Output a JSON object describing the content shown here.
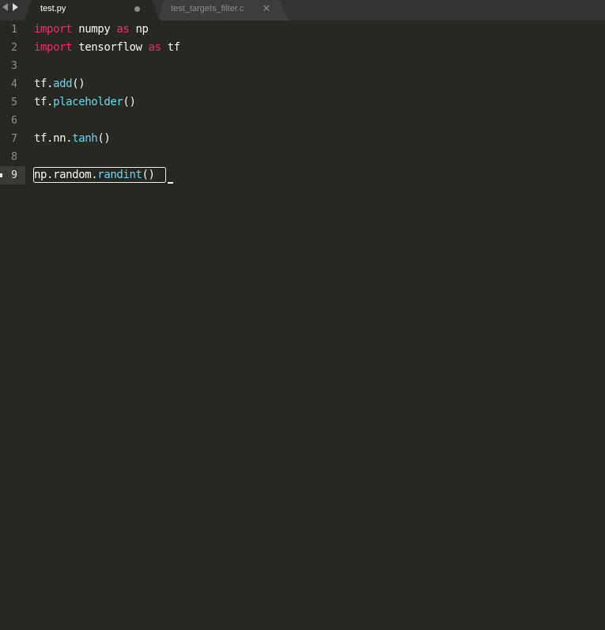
{
  "tabs": [
    {
      "label": "test.py",
      "active": true,
      "dirty": true
    },
    {
      "label": "test_targets_filter.c",
      "active": false,
      "close_icon": "close-icon"
    }
  ],
  "editor": {
    "line_numbers": [
      "1",
      "2",
      "3",
      "4",
      "5",
      "6",
      "7",
      "8",
      "9"
    ],
    "current_line": 9,
    "lines": [
      [
        {
          "t": "import",
          "c": "kw"
        },
        {
          "t": " numpy ",
          "c": "plain"
        },
        {
          "t": "as",
          "c": "kw"
        },
        {
          "t": " np",
          "c": "plain"
        }
      ],
      [
        {
          "t": "import",
          "c": "kw"
        },
        {
          "t": " tensorflow ",
          "c": "plain"
        },
        {
          "t": "as",
          "c": "kw"
        },
        {
          "t": " tf",
          "c": "plain"
        }
      ],
      [],
      [
        {
          "t": "tf.",
          "c": "plain"
        },
        {
          "t": "add",
          "c": "fn"
        },
        {
          "t": "()",
          "c": "plain"
        }
      ],
      [
        {
          "t": "tf.",
          "c": "plain"
        },
        {
          "t": "placeholder",
          "c": "fn"
        },
        {
          "t": "()",
          "c": "plain"
        }
      ],
      [],
      [
        {
          "t": "tf.nn.",
          "c": "plain"
        },
        {
          "t": "tanh",
          "c": "fn"
        },
        {
          "t": "()",
          "c": "plain"
        }
      ],
      [],
      [
        {
          "t": "np.random.",
          "c": "plain"
        },
        {
          "t": "randint",
          "c": "fn"
        },
        {
          "t": "()",
          "c": "plain"
        }
      ]
    ]
  },
  "colors": {
    "background": "#272822",
    "tabbar": "#333333",
    "keyword": "#f92672",
    "function": "#66d9ef",
    "text": "#f8f8f2",
    "gutter_text": "#90908a"
  }
}
